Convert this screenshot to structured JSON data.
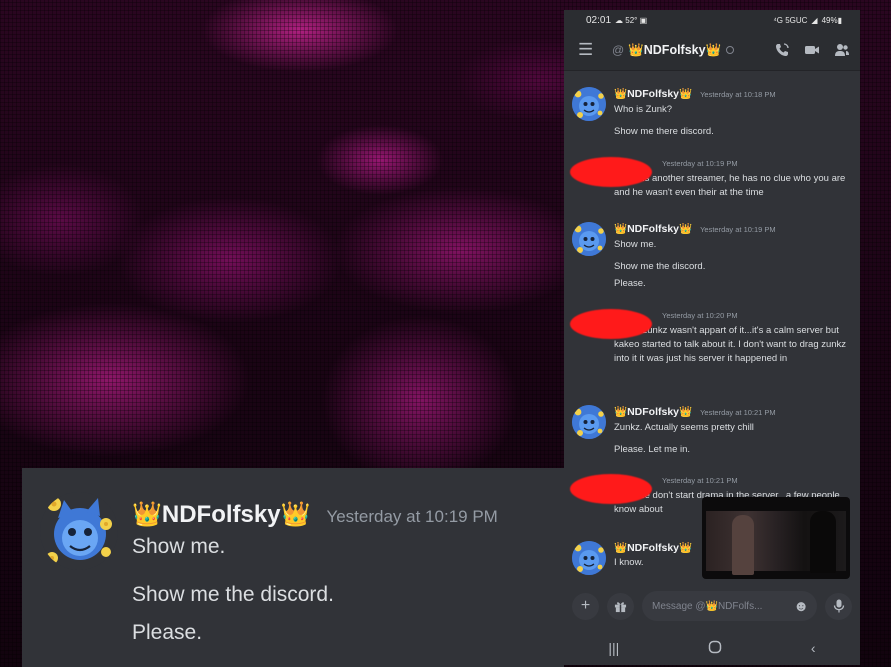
{
  "statusbar": {
    "time": "02:01",
    "icons_left": "☁ 52° ▣",
    "network": "⁴G 5GUC",
    "signal": "◢",
    "battery": "49%▮"
  },
  "topbar": {
    "at": "@",
    "channel_name": "👑NDFolfsky👑"
  },
  "messages": [
    {
      "author": "👑NDFolfsky👑",
      "time": "Yesterday at 10:18 PM",
      "lines": [
        "Who is Zunk?",
        "Show me there discord."
      ]
    },
    {
      "author": "",
      "time": "Yesterday at 10:19 PM",
      "lines": [
        "Zunkz is another streamer, he has no clue who you are and he wasn't even their at the time"
      ]
    },
    {
      "author": "👑NDFolfsky👑",
      "time": "Yesterday at 10:19 PM",
      "lines": [
        "Show me.",
        "Show me the discord.",
        "Please."
      ]
    },
    {
      "author": "",
      "time": "Yesterday at 10:20 PM",
      "lines": [
        "Look...zunkz wasn't appart of it...it's a calm server but kakeo started to talk about it. I don't want to drag zunkz into it it was just his server it happened in"
      ]
    },
    {
      "author": "👑NDFolfsky👑",
      "time": "Yesterday at 10:21 PM",
      "lines": [
        "Zunkz. Actually seems pretty chill",
        "Please. Let me in."
      ]
    },
    {
      "author": "",
      "time": "Yesterday at 10:21 PM",
      "lines": [
        "...please don't start drama in the server...a few people know about"
      ]
    },
    {
      "author": "👑NDFolfsky👑",
      "time": "",
      "lines": [
        "I know."
      ]
    }
  ],
  "input": {
    "placeholder": "Message @👑NDFolfs..."
  },
  "zoom": {
    "author": "👑NDFolfsky👑",
    "time": "Yesterday at 10:19 PM",
    "lines": [
      "Show me.",
      "Show me the discord.",
      "Please."
    ]
  },
  "colors": {
    "accent_redaction": "#ff1a1a",
    "panel": "#313338",
    "header": "#2b2d31"
  },
  "icons": [
    "menu-icon",
    "call-icon",
    "video-icon",
    "members-icon",
    "plus-icon",
    "gift-icon",
    "emoji-icon",
    "mic-icon",
    "recents-icon",
    "home-icon",
    "back-icon"
  ]
}
